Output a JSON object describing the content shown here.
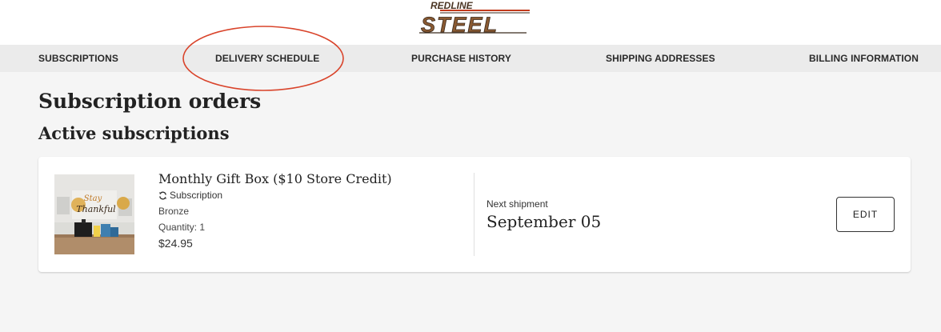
{
  "brand": {
    "logo_top_text": "REDLINE",
    "logo_main_text": "STEEL"
  },
  "nav": {
    "items": [
      {
        "label": "SUBSCRIPTIONS"
      },
      {
        "label": "DELIVERY SCHEDULE"
      },
      {
        "label": "PURCHASE HISTORY"
      },
      {
        "label": "SHIPPING ADDRESSES"
      },
      {
        "label": "BILLING INFORMATION"
      }
    ]
  },
  "page": {
    "title": "Subscription orders",
    "section_title": "Active subscriptions"
  },
  "subscription": {
    "product_name": "Monthly Gift Box ($10 Store Credit)",
    "type_label": "Subscription",
    "variant": "Bronze",
    "quantity_label": "Quantity: 1",
    "price": "$24.95",
    "next_shipment_label": "Next shipment",
    "next_shipment_date": "September 05",
    "edit_label": "EDIT",
    "image_text": {
      "line1": "Stay",
      "line2": "Thankful"
    }
  },
  "colors": {
    "annotation": "#d9442b",
    "logo_brown": "#8a5a32",
    "nav_bg": "#ebebeb",
    "page_bg": "#f5f5f5"
  },
  "icons": {
    "subscription": "refresh-icon"
  }
}
